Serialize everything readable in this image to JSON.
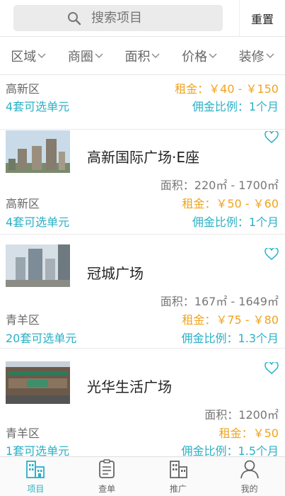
{
  "header": {
    "search_placeholder": "搜索项目",
    "reset_label": "重置"
  },
  "filters": [
    {
      "label": "区域"
    },
    {
      "label": "商圈"
    },
    {
      "label": "面积"
    },
    {
      "label": "价格"
    },
    {
      "label": "装修"
    }
  ],
  "listings": [
    {
      "district": "高新区",
      "rent": "租金：￥40 - ￥150",
      "units": "4套可选单元",
      "commission": "佣金比例：1个月"
    },
    {
      "name": "高新国际广场·E座",
      "area": "面积：220㎡ - 1700㎡",
      "district": "高新区",
      "rent": "租金：￥50 - ￥60",
      "units": "4套可选单元",
      "commission": "佣金比例：1个月"
    },
    {
      "name": "冠城广场",
      "area": "面积：167㎡ - 1649㎡",
      "district": "青羊区",
      "rent": "租金：￥75 - ￥80",
      "units": "20套可选单元",
      "commission": "佣金比例：1.3个月"
    },
    {
      "name": "光华生活广场",
      "area": "面积：1200㎡",
      "district": "青羊区",
      "rent": "租金：￥50",
      "units": "1套可选单元",
      "commission": "佣金比例：1.5个月"
    }
  ],
  "tabs": [
    {
      "label": "项目",
      "icon": "buildings-icon",
      "active": true
    },
    {
      "label": "查单",
      "icon": "clipboard-icon",
      "active": false
    },
    {
      "label": "推广",
      "icon": "building-icon",
      "active": false
    },
    {
      "label": "我的",
      "icon": "user-icon",
      "active": false
    }
  ],
  "colors": {
    "accent": "#2ab0c6",
    "rent": "#f0a31e"
  }
}
